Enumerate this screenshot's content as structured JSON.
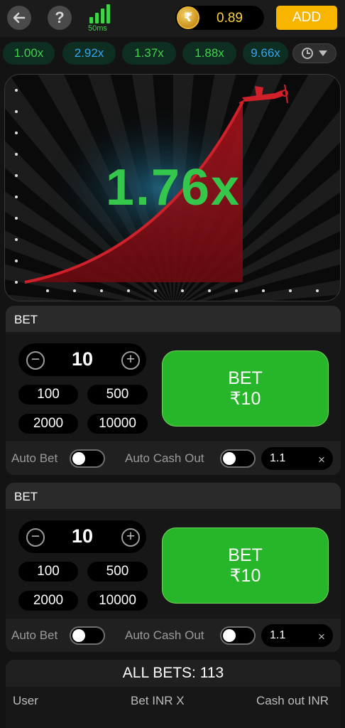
{
  "topbar": {
    "back_icon": "arrow-left-icon",
    "help_label": "?",
    "ping": "50ms",
    "currency_symbol": "₹",
    "balance": "0.89",
    "add_label": "ADD"
  },
  "history": {
    "multipliers": [
      {
        "value": "1.00x",
        "color": "#3fd34a"
      },
      {
        "value": "2.92x",
        "color": "#34a6ee"
      },
      {
        "value": "1.37x",
        "color": "#3fd34a"
      },
      {
        "value": "1.88x",
        "color": "#3fd34a"
      },
      {
        "value": "9.66x",
        "color": "#34a6ee"
      }
    ],
    "toggle_icon": "history-clock-icon"
  },
  "game": {
    "multiplier": "1.76x",
    "plane_icon": "airplane-icon",
    "accent": "#35c74b",
    "curve_color": "#d0202a"
  },
  "bet_panels": [
    {
      "title": "BET",
      "amount": "10",
      "minus": "−",
      "plus": "+",
      "quick_amounts": [
        "100",
        "500",
        "2000",
        "10000"
      ],
      "bet_button_line1": "BET",
      "bet_button_line2": "₹10",
      "auto_bet_label": "Auto Bet",
      "auto_cashout_label": "Auto Cash Out",
      "cashout_value": "1.1",
      "clear": "×"
    },
    {
      "title": "BET",
      "amount": "10",
      "minus": "−",
      "plus": "+",
      "quick_amounts": [
        "100",
        "500",
        "2000",
        "10000"
      ],
      "bet_button_line1": "BET",
      "bet_button_line2": "₹10",
      "auto_bet_label": "Auto Bet",
      "auto_cashout_label": "Auto Cash Out",
      "cashout_value": "1.1",
      "clear": "×"
    }
  ],
  "all_bets": {
    "title": "ALL BETS: 113",
    "columns": [
      "User",
      "Bet INR X",
      "Cash out INR"
    ]
  }
}
